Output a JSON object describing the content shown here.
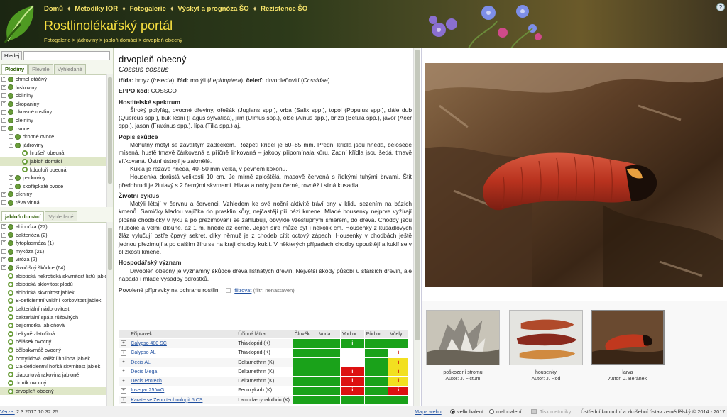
{
  "header": {
    "nav": [
      "Domů",
      "Metodiky IOR",
      "Fotogalerie",
      "Výskyt a prognóza ŠO",
      "Rezistence ŠO"
    ],
    "title": "Rostlinolékařský portál",
    "breadcrumb": "Fotogalerie > jádroviny > jabloň domácí > drvopleň obecný",
    "help": "?"
  },
  "left": {
    "search_button": "Hledej",
    "search_value": "",
    "tabs_top": [
      "Plodiny",
      "Plevele",
      "Vyhledané"
    ],
    "tree_top": [
      {
        "label": "chmel otáčivý",
        "exp": "+",
        "icon": "dot",
        "indent": 0
      },
      {
        "label": "luskoviny",
        "exp": "+",
        "icon": "dot",
        "indent": 0
      },
      {
        "label": "obilniny",
        "exp": "+",
        "icon": "dot",
        "indent": 0
      },
      {
        "label": "okopaniny",
        "exp": "+",
        "icon": "dot",
        "indent": 0
      },
      {
        "label": "okrasné rostliny",
        "exp": "+",
        "icon": "dot",
        "indent": 0
      },
      {
        "label": "olejniny",
        "exp": "+",
        "icon": "dot",
        "indent": 0
      },
      {
        "label": "ovoce",
        "exp": "-",
        "icon": "dot",
        "indent": 0
      },
      {
        "label": "drobné ovoce",
        "exp": "+",
        "icon": "dot",
        "indent": 1
      },
      {
        "label": "jádroviny",
        "exp": "-",
        "icon": "dot",
        "indent": 1
      },
      {
        "label": "hrušeň obecná",
        "exp": "",
        "icon": "ring",
        "indent": 2
      },
      {
        "label": "jabloň domácí",
        "exp": "",
        "icon": "ring",
        "indent": 2,
        "selected": true
      },
      {
        "label": "kdouloň obecná",
        "exp": "",
        "icon": "ring",
        "indent": 2
      },
      {
        "label": "peckoviny",
        "exp": "+",
        "icon": "dot",
        "indent": 1
      },
      {
        "label": "skořápkaté ovoce",
        "exp": "+",
        "icon": "dot",
        "indent": 1
      },
      {
        "label": "pícniny",
        "exp": "+",
        "icon": "dot",
        "indent": 0
      },
      {
        "label": "réva vinná",
        "exp": "+",
        "icon": "dot",
        "indent": 0
      }
    ],
    "tabs_bottom": [
      "jabloň domácí",
      "Vyhledané"
    ],
    "tree_bottom": [
      {
        "label": "abionóza (27)",
        "exp": "+",
        "icon": "dot",
        "indent": 0
      },
      {
        "label": "bakterióza (2)",
        "exp": "+",
        "icon": "dot",
        "indent": 0
      },
      {
        "label": "fytoplasmóza (1)",
        "exp": "+",
        "icon": "dot",
        "indent": 0
      },
      {
        "label": "mykóza (21)",
        "exp": "+",
        "icon": "dot",
        "indent": 0
      },
      {
        "label": "viróza (2)",
        "exp": "+",
        "icon": "dot",
        "indent": 0
      },
      {
        "label": "živočišný škůdce (64)",
        "exp": "+",
        "icon": "dot",
        "indent": 0
      },
      {
        "label": "abiotická nekrotická skvrnitost listů jabloně",
        "exp": "",
        "icon": "ring",
        "indent": 0
      },
      {
        "label": "abiotická sklovitost plodů",
        "exp": "",
        "icon": "ring",
        "indent": 0
      },
      {
        "label": "abiotická skvrnitost jablek",
        "exp": "",
        "icon": "ring",
        "indent": 0
      },
      {
        "label": "B-deficientní vnitřní korkovitost jablek",
        "exp": "",
        "icon": "ring",
        "indent": 0
      },
      {
        "label": "bakteriální nádorovitost",
        "exp": "",
        "icon": "ring",
        "indent": 0
      },
      {
        "label": "bakteriální spála růžovitých",
        "exp": "",
        "icon": "ring",
        "indent": 0
      },
      {
        "label": "bejlomorka jabloňová",
        "exp": "",
        "icon": "ring",
        "indent": 0
      },
      {
        "label": "bekyně zlatořitná",
        "exp": "",
        "icon": "ring",
        "indent": 0
      },
      {
        "label": "bělásek ovocný",
        "exp": "",
        "icon": "ring",
        "indent": 0
      },
      {
        "label": "běloskvrnáč ovocný",
        "exp": "",
        "icon": "ring",
        "indent": 0
      },
      {
        "label": "botrytidová kališní hniloba jablek",
        "exp": "",
        "icon": "ring",
        "indent": 0
      },
      {
        "label": "Ca-deficientní hořká skvrnitost jablek",
        "exp": "",
        "icon": "ring",
        "indent": 0
      },
      {
        "label": "diaportová rakovina jabloně",
        "exp": "",
        "icon": "ring",
        "indent": 0
      },
      {
        "label": "drtník ovocný",
        "exp": "",
        "icon": "ring",
        "indent": 0
      },
      {
        "label": "drvopleň obecný",
        "exp": "",
        "icon": "ring",
        "indent": 0,
        "selected": true
      }
    ]
  },
  "content": {
    "title": "drvopleň obecný",
    "latin": "Cossus cossus",
    "taxonomy": {
      "trida_label": "třída:",
      "trida": "hmyz",
      "trida_lat": "Insecta",
      "rad_label": "řád:",
      "rad": "motýli",
      "rad_lat": "Lepidoptera",
      "celed_label": "čeleď:",
      "celed": "drvopleňovití",
      "celed_lat": "Cossidae"
    },
    "eppo_label": "EPPO kód:",
    "eppo": "COSSCO",
    "sections": [
      {
        "heading": "Hostitelské spektrum",
        "paras": [
          "Široký polyfág, ovocné dřeviny, ořešák (Juglans spp.), vrba (Salix spp.), topol (Populus spp.), dále dub (Quercus spp.), buk lesní (Fagus sylvatica), jilm (Ulmus spp.), olše (Alnus spp.), bříza (Betula spp.), javor (Acer spp.), jasan (Fraxinus spp.), lípa (Tilia spp.) aj."
        ]
      },
      {
        "heading": "Popis škůdce",
        "paras": [
          "Mohutný motýl se zavalitým zadečkem. Rozpětí křídel je 60–85 mm. Přední křídla jsou hnědá, bělošedě mísená, hustě tmavě čárkovaná a příčně linkovaná – jakoby připomínala kůru. Zadní křídla jsou šedá, tmavě síťkovaná. Ústní ústrojí je zakrnělé.",
          "Kukla je rezavě hnědá, 40–50 mm velká, v pevném kokonu.",
          "Housenka dorůstá velikosti 10 cm. Je mírně zploštělá, masově červená s řídkými tuhými brvami. Štít předohrudi je žlutavý s 2 černými skvrnami. Hlava a nohy jsou černé, rovněž i silná kusadla."
        ]
      },
      {
        "heading": "Životní cyklus",
        "paras": [
          "Motýli létají v červnu a červenci. Vzhledem ke své noční aktivitě tráví dny v klidu sezením na bázích kmenů. Samičky kladou vajíčka do prasklin kůry, nejčastěji při bázi kmene. Mladé housenky nejprve vyžírají plošné chodbičky v lýku a po přezimování se zahlubují, obvykle vzestupným směrem, do dřeva. Chodby jsou hluboké a velmi dlouhé, až 1 m, hnědé až černé. Jejich šíře může být i několik cm. Housenky z kusadlových žláz vylučují ostře čpavý sekret, díky němuž je z chodeb cítit octový zápach. Housenky v chodbách ještě jednou přezimují a po dalším žíru se na kraji chodby kuklí. V některých případech chodby opouštějí a kuklí se v blízkosti kmene."
        ]
      },
      {
        "heading": "Hospodářský význam",
        "paras": [
          "Drvopleň obecný je významný škůdce dřeva listnatých dřevin. Největší škody působí u starších dřevin, ale napadá i mladé výsadby odrostků."
        ]
      }
    ],
    "products_heading": "Povolené přípravky na ochranu rostlin",
    "filter_link": "filtrovat",
    "filter_state": "(filtr: nenastaven)",
    "table_headers": [
      "Přípravek",
      "Účinná látka",
      "Člověk",
      "Voda",
      "Vod.or...",
      "Půd.or...",
      "Včely"
    ],
    "products": [
      {
        "name": "Calypso 480 SC",
        "substance": "Thiakloprid (K)",
        "c": [
          "g",
          "g",
          "gi",
          "g",
          "g"
        ]
      },
      {
        "name": "Calypso AL",
        "substance": "Thiakloprid (K)",
        "c": [
          "g",
          "g",
          "w",
          "g",
          "wi"
        ]
      },
      {
        "name": "Decis AL",
        "substance": "Deltamethrin (K)",
        "c": [
          "g",
          "g",
          "w",
          "g",
          "y"
        ]
      },
      {
        "name": "Decis Mega",
        "substance": "Deltamethrin (K)",
        "c": [
          "g",
          "g",
          "r",
          "g",
          "y"
        ]
      },
      {
        "name": "Decis Protech",
        "substance": "Deltamethrin (K)",
        "c": [
          "g",
          "g",
          "r",
          "g",
          "y"
        ]
      },
      {
        "name": "Insegar 25 WG",
        "substance": "Fenoxykarb (K)",
        "c": [
          "g",
          "g",
          "r",
          "g",
          "r"
        ]
      },
      {
        "name": "Karate se Zeon technologií 5 CS",
        "substance": "Lambda-cyhalothrin (K)",
        "c": [
          "g",
          "g",
          "g",
          "g",
          "g"
        ]
      }
    ],
    "mark": "i"
  },
  "gallery": [
    {
      "caption": "poškození stromu",
      "author": "Autor: J. Fictum"
    },
    {
      "caption": "housenky",
      "author": "Autor: J. Rod"
    },
    {
      "caption": "larva",
      "author": "Autor: J. Beránek",
      "selected": true
    }
  ],
  "footer": {
    "version": "Verze:",
    "date": "2.3.2017 10:32:25",
    "sitemap": "Mapa webu",
    "size_large": "velkobalení",
    "size_small": "malobalení",
    "print": "Tisk metodiky",
    "institution": "Ústřední kontrolní a zkušební ústav zemědělský © 2014 - 2017"
  }
}
